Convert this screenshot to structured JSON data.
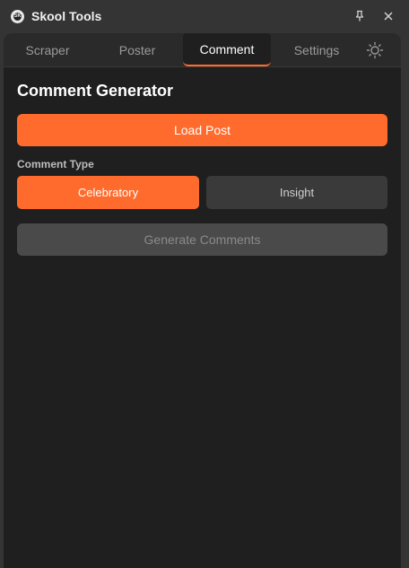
{
  "window": {
    "title": "Skool Tools",
    "logo_text": "SK"
  },
  "tabs": [
    {
      "label": "Scraper",
      "active": false
    },
    {
      "label": "Poster",
      "active": false
    },
    {
      "label": "Comment",
      "active": true
    },
    {
      "label": "Settings",
      "active": false
    }
  ],
  "icons": {
    "logo": "app-logo-icon",
    "pin": "pin-icon",
    "close": "close-icon",
    "theme": "sun-icon"
  },
  "comment": {
    "heading": "Comment Generator",
    "load_post_label": "Load Post",
    "comment_type_label": "Comment Type",
    "types": [
      {
        "label": "Celebratory",
        "selected": true
      },
      {
        "label": "Insight",
        "selected": false
      }
    ],
    "generate_label": "Generate Comments",
    "generate_enabled": false
  },
  "colors": {
    "accent": "#ff6b2c",
    "panel_bg": "#1f1f1f",
    "window_bg": "#343434",
    "disabled_bg": "#4a4a4a"
  }
}
